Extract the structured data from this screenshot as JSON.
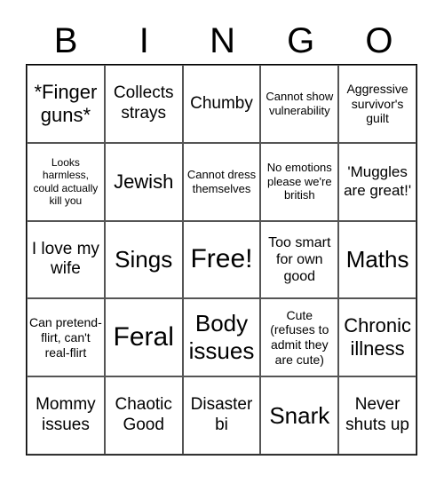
{
  "header": {
    "letters": [
      "B",
      "I",
      "N",
      "G",
      "O"
    ]
  },
  "cells": [
    [
      "*Finger guns*",
      "Collects strays",
      "Chumby",
      "Cannot show vulnerability",
      "Aggressive survivor's guilt"
    ],
    [
      "Looks harmless, could actually kill you",
      "Jewish",
      "Cannot dress themselves",
      "No emotions please we're british",
      "'Muggles are great!'"
    ],
    [
      "I love my wife",
      "Sings",
      "Free!",
      "Too smart for own good",
      "Maths"
    ],
    [
      "Can pretend-flirt, can't real-flirt",
      "Feral",
      "Body issues",
      "Cute (refuses to admit they are cute)",
      "Chronic illness"
    ],
    [
      "Mommy issues",
      "Chaotic Good",
      "Disaster bi",
      "Snark",
      "Never shuts up"
    ]
  ]
}
